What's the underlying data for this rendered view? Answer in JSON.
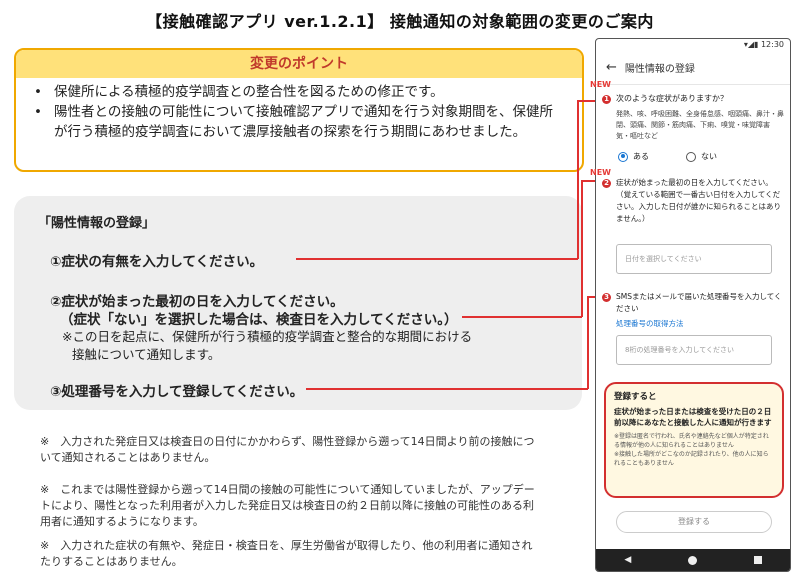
{
  "title": "【接触確認アプリ ver.1.2.1】 接触通知の対象範囲の変更のご案内",
  "point": {
    "heading": "変更のポイント",
    "items": [
      "保健所による積極的疫学調査との整合性を図るための修正です。",
      "陽性者との接触の可能性について接触確認アプリで通知を行う対象期間を、保健所が行う積極的疫学調査において濃厚接触者の探索を行う期間にあわせました。"
    ]
  },
  "registration": {
    "title": "「陽性情報の登録」",
    "step1": "①症状の有無を入力してください。",
    "step2": "②症状が始まった最初の日を入力してください。",
    "step2_sub": "（症状「ない」を選択した場合は、検査日を入力してください。）",
    "step2_note_1": "※この日を起点に、保健所が行う積極的疫学調査と整合的な期間における",
    "step2_note_2": "接触について通知します。",
    "step3": "③処理番号を入力して登録してください。"
  },
  "notes": [
    "※　入力された発症日又は検査日の日付にかかわらず、陽性登録から遡って14日間より前の接触について通知されることはありません。",
    "※　これまでは陽性登録から遡って14日間の接触の可能性について通知していましたが、アップデートにより、陽性となった利用者が入力した発症日又は検査日の約２日前以降に接触の可能性のある利用者に通知するようになります。",
    "※　入力された症状の有無や、発症日・検査日を、厚生労働省が取得したり、他の利用者に通知されたりすることはありません。"
  ],
  "phone": {
    "time": "12:30",
    "appbar_title": "陽性情報の登録",
    "new_label": "NEW",
    "q1": "次のような症状がありますか？",
    "q1_detail": "発熱、咳、呼吸困難、全身倦怠感、咽頭痛、鼻汁・鼻閉、頭痛、関節・筋肉痛、下痢、嗅覚・味覚障害",
    "q1_detail_cont": "気・嘔吐など",
    "radio_yes": "ある",
    "radio_no": "ない",
    "q2": "症状が始まった最初の日を入力してください。（覚えている範囲で一番古い日付を入力してください。入力した日付が誰かに知られることはありません。）",
    "date_placeholder": "日付を選択してください",
    "q3": "SMSまたはメールで届いた処理番号を入力してください",
    "q3_link": "処理番号の取得方法",
    "code_placeholder": "8桁の処理番号を入力してください",
    "notice_head": "登録すると",
    "notice_body": "症状が始まった日または検査を受けた日の２日前以降にあなたと接触した人に通知が行きます",
    "notice_small": "※登録は匿名で行われ、氏名や連絡先など個人が特定される情報が他の人に知られることはありません\n※接触した場所がどこなのか記録されたり、他の人に知られることもありません",
    "register_button": "登録する"
  }
}
